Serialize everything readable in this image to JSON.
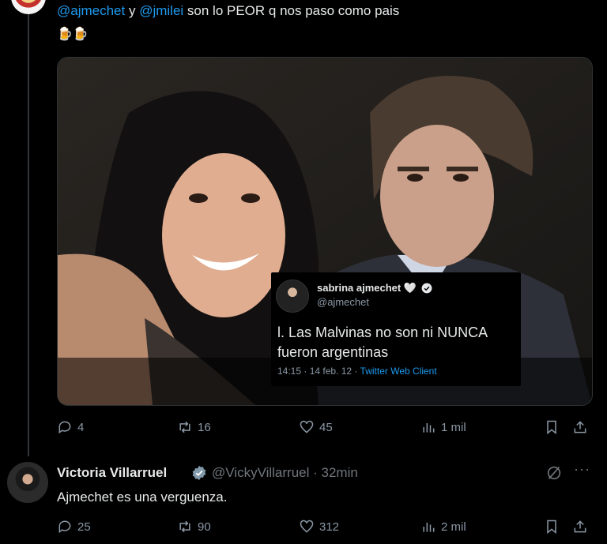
{
  "tweet": {
    "mention1": "@ajmechet",
    "conjunction": " y ",
    "mention2": "@jmilei",
    "text_rest": " son lo PEOR q nos paso como pais",
    "emojis": "🍺🍺",
    "embedded": {
      "name": "sabrina ajmechet 🤍",
      "handle": "@ajmechet",
      "text_line1": "l. Las Malvinas no son ni NUNCA",
      "text_line2": "fueron argentinas",
      "time": "14:15 · 14 feb. 12 · ",
      "client": "Twitter Web Client"
    },
    "actions": {
      "replies": "4",
      "retweets": "16",
      "likes": "45",
      "views": "1 mil"
    }
  },
  "reply": {
    "name": "Victoria Villarruel",
    "handle": "@VickyVillarruel · 32min",
    "text": "Ajmechet es una verguenza.",
    "more": "···",
    "actions": {
      "replies": "25",
      "retweets": "90",
      "likes": "312",
      "views": "2 mil"
    }
  },
  "colors": {
    "accent": "#1d9bf0",
    "muted": "#71767b",
    "text": "#e7e9ea",
    "background": "#000000"
  }
}
